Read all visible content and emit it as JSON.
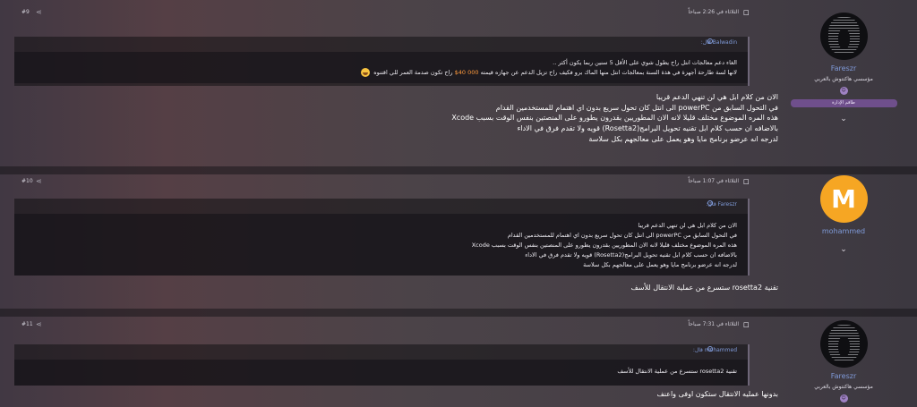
{
  "posts": [
    {
      "num": "#9",
      "date": "الثلاثاء في 2:26 صباحاً",
      "quote": {
        "author": "Balwadin قال:",
        "line1": "الغاء دعم معالجات انتل راح يطول شوي على الأقل 5 سنين ربما يكون أكثر ..",
        "line2_a": "لانها لسة طارحة أجهزة في هذة السنة بمعالجات انتل منها الماك برو فكيف راح تزيل الدعم عن جهازه قيمته",
        "line2_hl": "000 40$",
        "line2_b": "راح تكون صدمة العمر للي اقتنوه"
      },
      "text": [
        "الان من كلام ابل هي لن تنهي الدعم قريبا",
        "في التحول السابق من powerPC الى انتل كان تحول سريع بدون اي اهتمام للمستخدمين القدام",
        "هذه المره الموضوع مختلف قليلا لانه الان المطوريين بقدرون يطورو على المنصتين بنفس الوقت بسبب Xcode",
        "بالاضافه ان حسب كلام ابل تقنيه تحويل البرامج(Rosetta2) قويه ولا تقدم فرق في الاداء",
        "لدرجه انه عرضو برنامج مايا وهو يعمل على معالجهم بكل سلاسة"
      ],
      "user": {
        "name": "Fareszr",
        "title": "مؤسسي هاكنتوش بالعربي",
        "rank": "طاقم الإدارة",
        "avatar": "masked-figure-avatar",
        "badge_icon": "user-badge-icon"
      }
    },
    {
      "num": "#10",
      "date": "الثلاثاء في 1:07 صباحاً",
      "quote": {
        "author": "Fareszr قال:",
        "lines": [
          "الان من كلام ابل هي لن تنهي الدعم قريبا",
          "في التحول السابق من powerPC الى انتل كان تحول سريع بدون اي اهتمام للمستخدمين القدام",
          "هذه المره الموضوع مختلف قليلا لانه الان المطوريين بقدرون يطورو على المنصتين بنفس الوقت بسبب Xcode",
          "بالاضافه ان حسب كلام ابل تقنيه تحويل البرامج(Rosetta2) قويه ولا تقدم فرق في الاداء",
          "لدرجه انه عرضو برنامج مايا وهو يعمل على معالجهم بكل سلاسة"
        ]
      },
      "text": [
        "تقنية rosetta2 ستسرع من عملية الانتقال للأسف"
      ],
      "user": {
        "name": "mohammed",
        "avatar_letter": "M",
        "avatar_color": "#f6a623"
      }
    },
    {
      "num": "#11",
      "date": "الثلاثاء في 7:31 صباحاً",
      "quote": {
        "author": "mohammed قال:",
        "lines": [
          "تقنية rosetta2 ستسرع من عملية الانتقال للأسف"
        ]
      },
      "text": [
        "بدونها عمليه الانتقال ستكون اوفى واعنف"
      ],
      "user": {
        "name": "Fareszr",
        "title": "مؤسسي هاكنتوش بالعربي",
        "badge_icon": "user-badge-icon"
      }
    }
  ],
  "icons": {
    "share": "share-icon",
    "bookmark": "bookmark-dot-icon",
    "expand": "chevron-down-icon",
    "quote_jump": "arrow-up-circle-icon"
  },
  "colors": {
    "link": "#7f9ad8",
    "highlight": "#ff9a3c",
    "rank_bg": "#6f4f8c",
    "avatar_m": "#f6a623"
  }
}
